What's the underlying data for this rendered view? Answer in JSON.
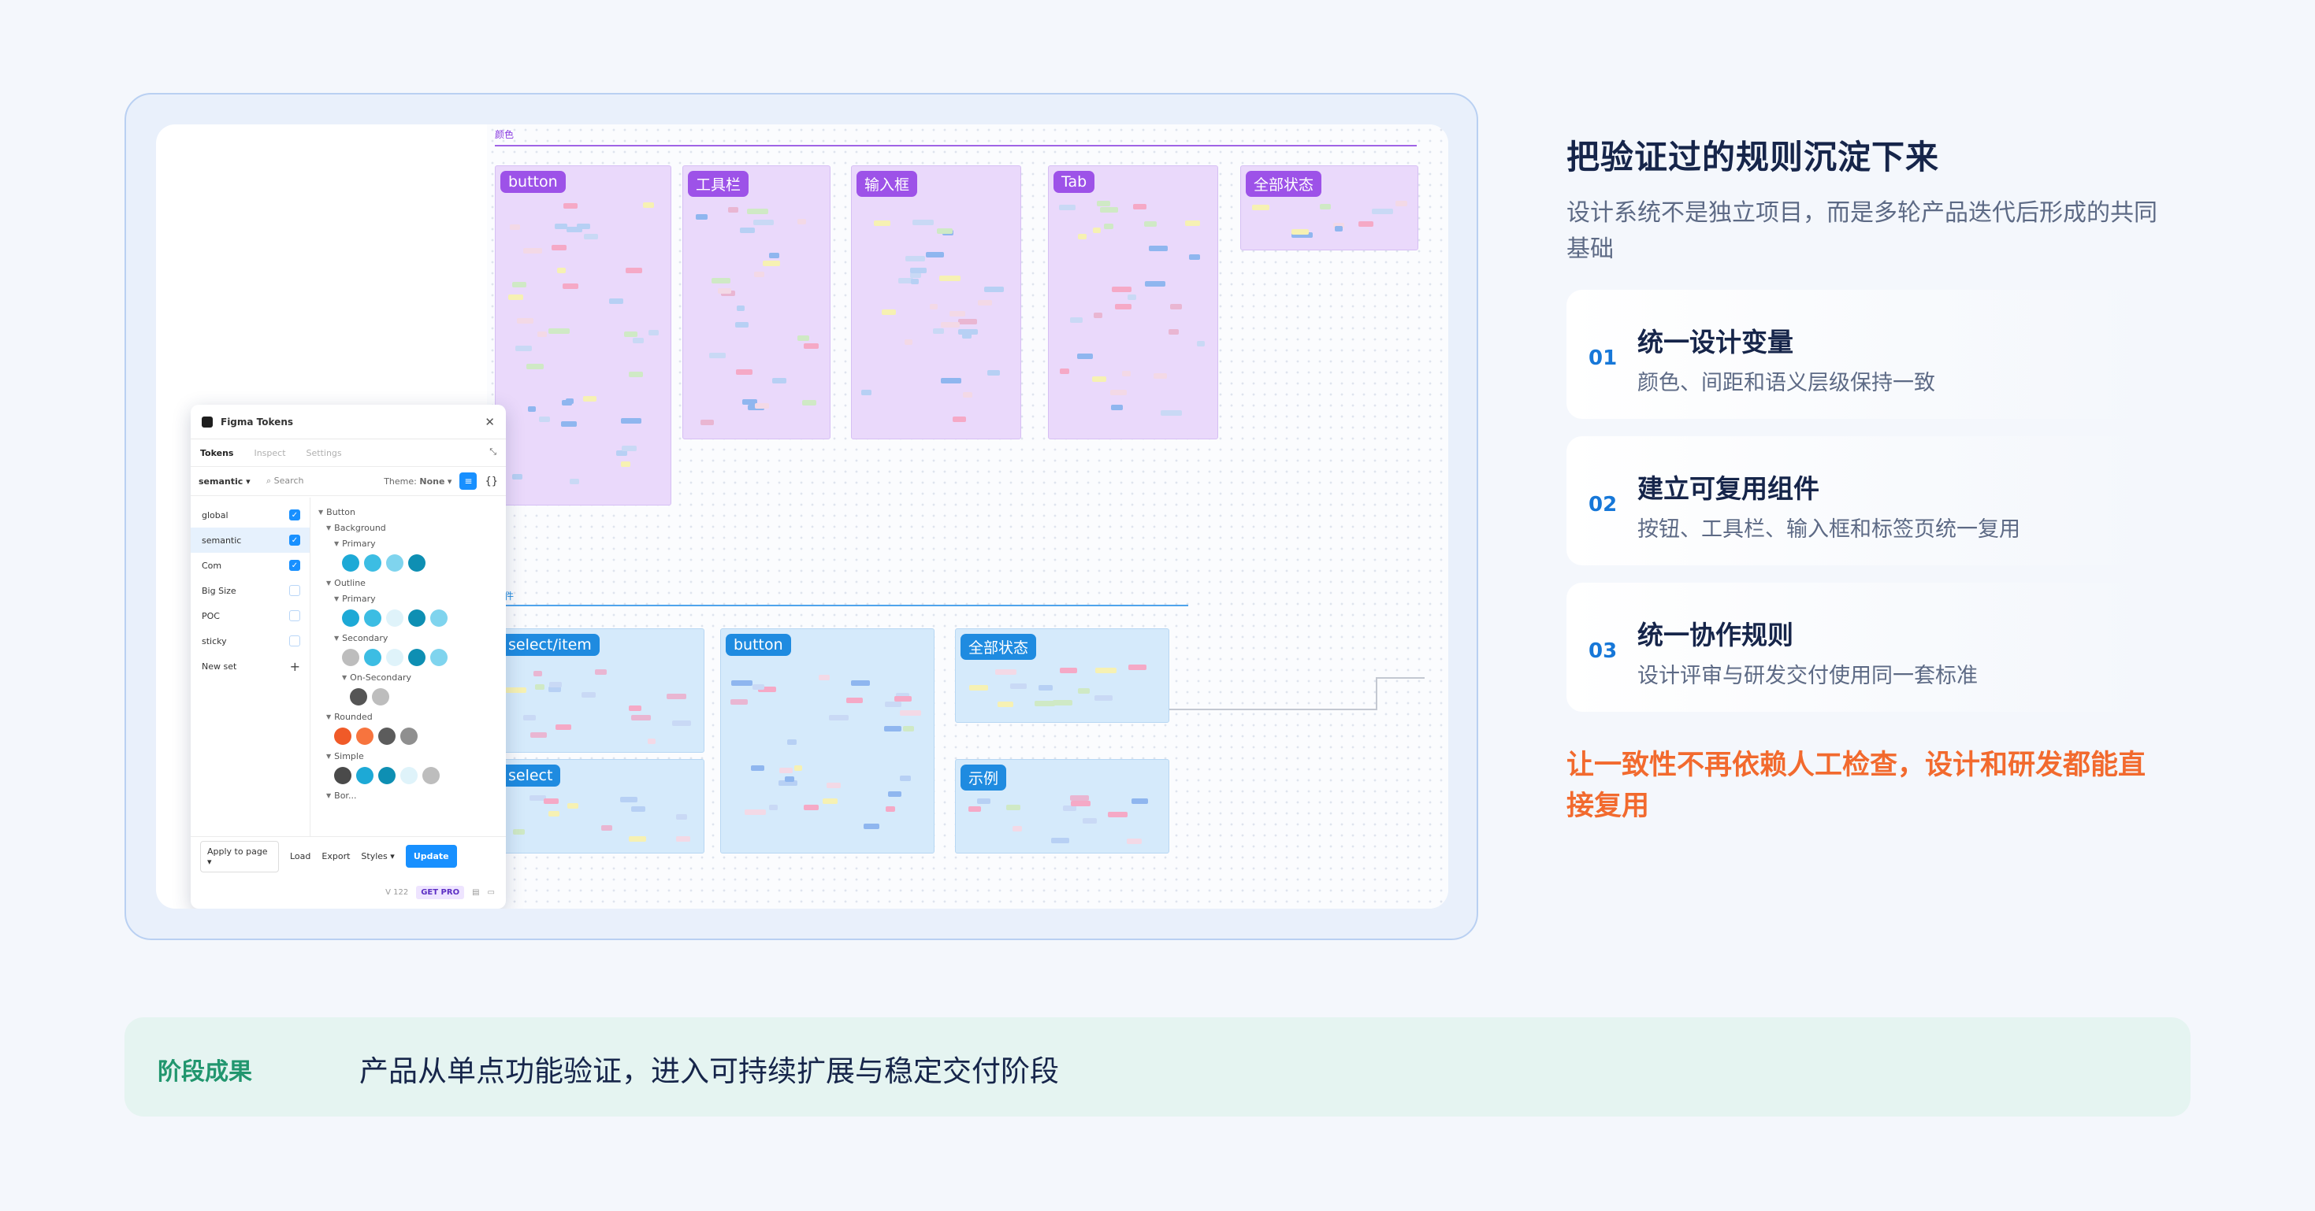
{
  "canvas": {
    "section_color_label": "颜色",
    "section_component_label": "组件",
    "purple_frames": [
      {
        "tag": "button"
      },
      {
        "tag": "工具栏"
      },
      {
        "tag": "输入框"
      },
      {
        "tag": "Tab"
      },
      {
        "tag": "全部状态"
      }
    ],
    "blue_frames": [
      {
        "tag": "select/item"
      },
      {
        "tag": "button"
      },
      {
        "tag": "全部状态"
      },
      {
        "tag": "select"
      },
      {
        "tag": "示例"
      }
    ]
  },
  "plugin": {
    "title": "Figma Tokens",
    "tabs": [
      "Tokens",
      "Inspect",
      "Settings"
    ],
    "active_tab": "Tokens",
    "token_set_select": "semantic",
    "search_placeholder": "Search",
    "theme_label": "Theme:",
    "theme_value": "None",
    "sets": [
      {
        "name": "global",
        "checked": true
      },
      {
        "name": "semantic",
        "checked": true,
        "selected": true
      },
      {
        "name": "Com",
        "checked": true
      },
      {
        "name": "Big Size",
        "checked": false
      },
      {
        "name": "POC",
        "checked": false
      },
      {
        "name": "sticky",
        "checked": false
      }
    ],
    "new_set_label": "New set",
    "tree": {
      "button": "Button",
      "background": "Background",
      "primary": "Primary",
      "outline": "Outline",
      "outline_primary": "Primary",
      "secondary": "Secondary",
      "on_secondary": "On-Secondary",
      "rounded": "Rounded",
      "simple": "Simple",
      "more": "Bor..."
    },
    "swatches": {
      "bg_primary": [
        "#1da9d6",
        "#3cbde3",
        "#7fd4ee",
        "#0e8fb3"
      ],
      "outline_primary": [
        "#1da9d6",
        "#3cbde3",
        "#dff3fa",
        "#0e8fb3",
        "#7fd4ee"
      ],
      "secondary": [
        "#bdbdbd",
        "#3cbde3",
        "#dff3fa",
        "#0e8fb3",
        "#7fd4ee"
      ],
      "on_secondary": [
        "#555555",
        "#bdbdbd"
      ],
      "rounded": [
        "#f05a28",
        "#f7743e",
        "#5c5c5c",
        "#8f8f8f"
      ],
      "simple": [
        "#4a4a4a",
        "#1da9d6",
        "#0e8fb3",
        "#dff3fa",
        "#bdbdbd"
      ]
    },
    "footer": {
      "apply": "Apply to page",
      "load": "Load",
      "export": "Export",
      "styles": "Styles",
      "update": "Update"
    },
    "version": "V 122",
    "get_pro": "GET PRO"
  },
  "content": {
    "heading": "把验证过的规则沉淀下来",
    "subheading": "设计系统不是独立项目，而是多轮产品迭代后形成的共同基础",
    "items": [
      {
        "num": "01",
        "title": "统一设计变量",
        "desc": "颜色、间距和语义层级保持一致"
      },
      {
        "num": "02",
        "title": "建立可复用组件",
        "desc": "按钮、工具栏、输入框和标签页统一复用"
      },
      {
        "num": "03",
        "title": "统一协作规则",
        "desc": "设计评审与研发交付使用同一套标准"
      }
    ],
    "highlight": "让一致性不再依赖人工检查，设计和研发都能直接复用"
  },
  "result": {
    "label": "阶段成果",
    "text": "产品从单点功能验证，进入可持续扩展与稳定交付阶段"
  },
  "colors": {
    "accent_blue": "#1677d8",
    "accent_orange": "#f26a2e",
    "accent_green": "#21966e",
    "frame_purple": "#ead9fb",
    "frame_blue": "#d5eafb"
  }
}
